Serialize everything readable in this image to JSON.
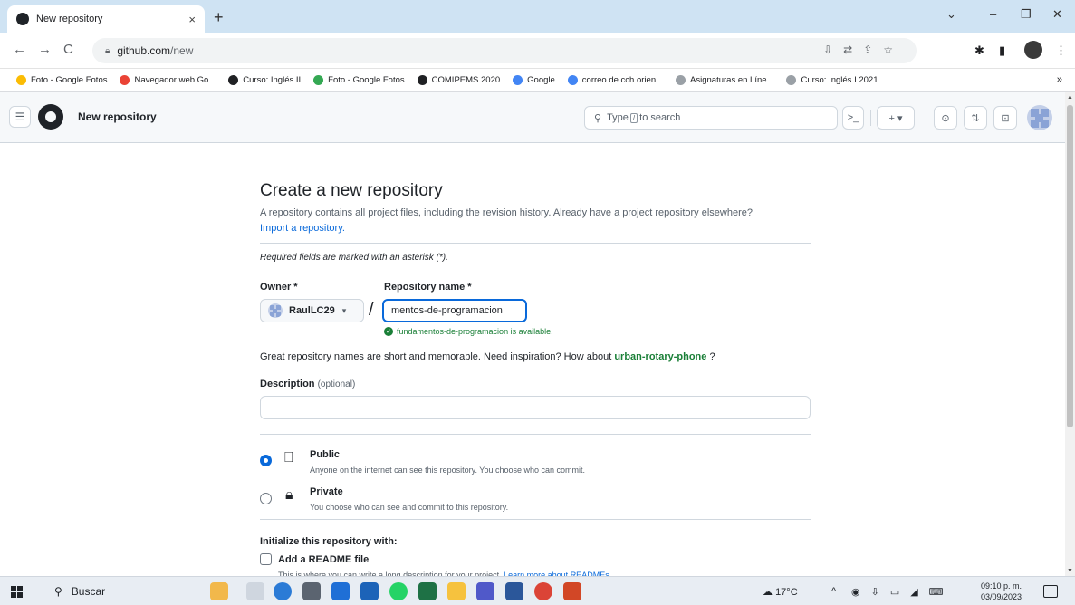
{
  "browser": {
    "tab_title": "New repository",
    "tab_close": "×",
    "new_tab": "+",
    "url_host": "github.com",
    "url_path": "/new",
    "bookmarks": [
      {
        "label": "Foto - Google Fotos",
        "color": "#fbbc04"
      },
      {
        "label": "Navegador web Go...",
        "color": "#ea4335"
      },
      {
        "label": "Curso: Inglés II",
        "color": "#202124"
      },
      {
        "label": "Foto - Google Fotos",
        "color": "#34a853"
      },
      {
        "label": "COMIPEMS 2020",
        "color": "#202124"
      },
      {
        "label": "Google",
        "color": "#4285f4"
      },
      {
        "label": "correo de cch orien...",
        "color": "#4285f4"
      },
      {
        "label": "Asignaturas en Líne...",
        "color": "#9aa0a6"
      },
      {
        "label": "Curso: Inglés I 2021...",
        "color": "#9aa0a6"
      }
    ],
    "bookmarks_more": "»"
  },
  "github_header": {
    "context": "New repository",
    "search_pre": "Type",
    "search_key": "/",
    "search_post": "to search"
  },
  "form": {
    "title": "Create a new repository",
    "subtitle": "A repository contains all project files, including the revision history. Already have a project repository elsewhere?",
    "import_link": "Import a repository.",
    "required_note": "Required fields are marked with an asterisk (*).",
    "owner_label": "Owner *",
    "owner_value": "RaulLC29",
    "repo_label": "Repository name *",
    "repo_value": "mentos-de-programacion",
    "availability": "fundamentos-de-programacion is available.",
    "great_names_text": "Great repository names are short and memorable. Need inspiration? How about",
    "suggestion": "urban-rotary-phone",
    "suggestion_tail": " ?",
    "description_label": "Description",
    "description_optional": "(optional)",
    "description_value": "",
    "public_title": "Public",
    "public_desc": "Anyone on the internet can see this repository. You choose who can commit.",
    "private_title": "Private",
    "private_desc": "You choose who can see and commit to this repository.",
    "visibility_selected": "public",
    "init_title": "Initialize this repository with:",
    "readme_label": "Add a README file",
    "readme_desc": "This is where you can write a long description for your project.",
    "readme_link": "Learn more about READMEs."
  },
  "taskbar": {
    "search": "Buscar",
    "temperature": "17°C",
    "time": "09:10 p. m.",
    "date": "03/09/2023"
  },
  "colors": {
    "accent": "#0969da",
    "success": "#1a7f37",
    "tabstrip": "#cfe3f3"
  }
}
